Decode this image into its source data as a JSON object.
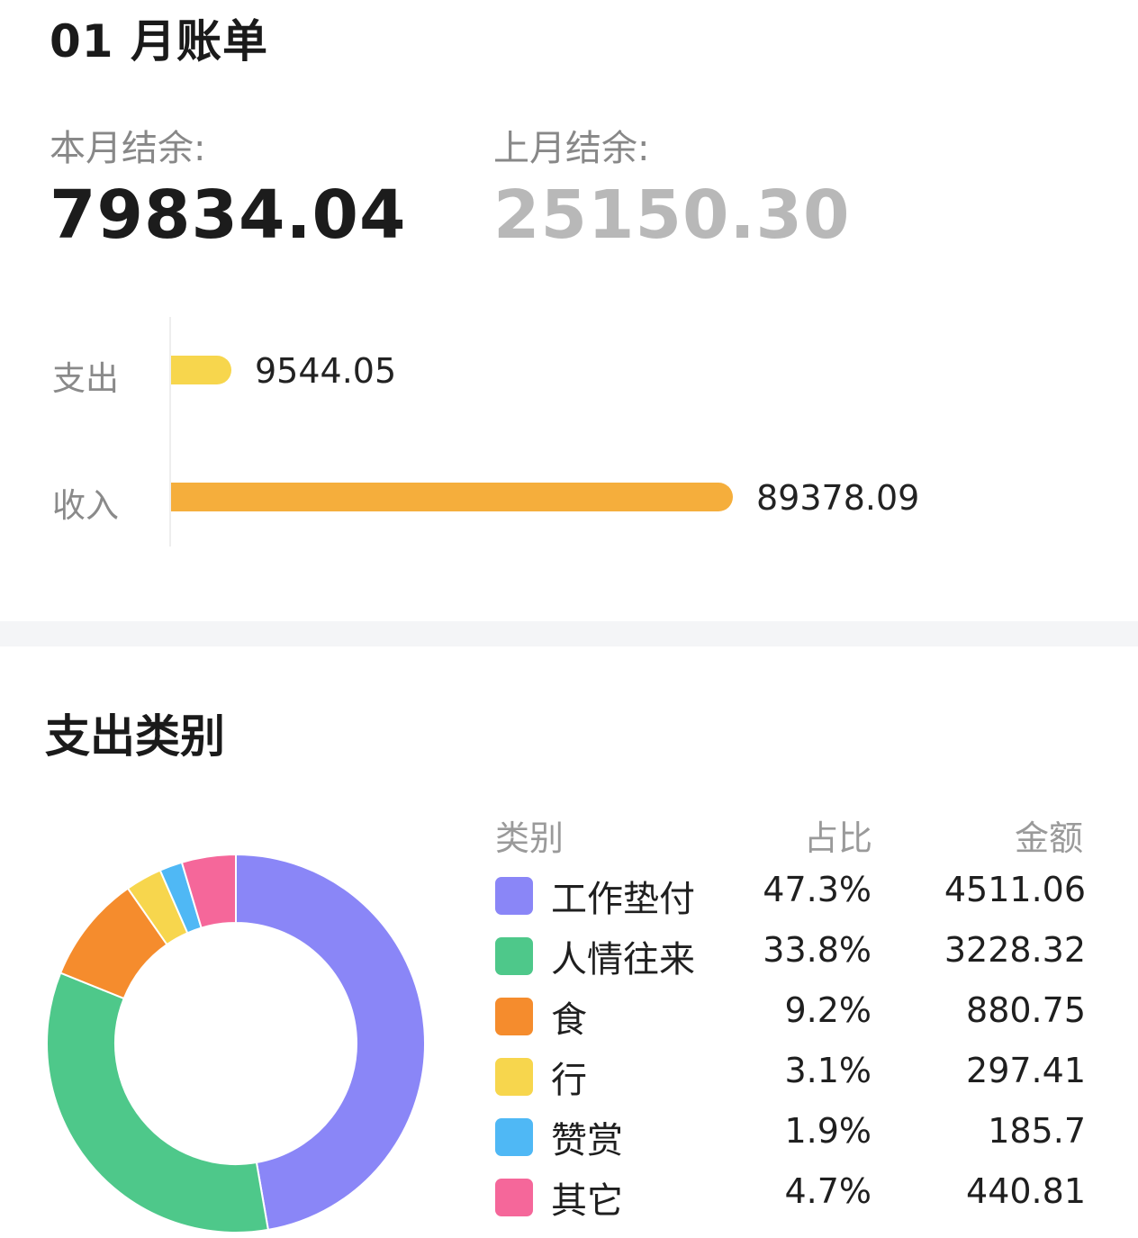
{
  "header": {
    "title": "01 月账单"
  },
  "balance": {
    "current_label": "本月结余:",
    "current_value": "79834.04",
    "previous_label": "上月结余:",
    "previous_value": "25150.30"
  },
  "summary_bars": {
    "items": [
      {
        "label": "支出",
        "value": 9544.05,
        "value_text": "9544.05",
        "color": "#f7d64d"
      },
      {
        "label": "收入",
        "value": 89378.09,
        "value_text": "89378.09",
        "color": "#f5ae3c"
      }
    ]
  },
  "section": {
    "title": "支出类别"
  },
  "chart_data": {
    "type": "pie",
    "style": "donut",
    "columns": [
      "类别",
      "占比",
      "金额"
    ],
    "slices": [
      {
        "label": "工作垫付",
        "percent": 47.3,
        "percent_text": "47.3%",
        "value": 4511.06,
        "value_text": "4511.06",
        "color": "#8a86f7"
      },
      {
        "label": "人情往来",
        "percent": 33.8,
        "percent_text": "33.8%",
        "value": 3228.32,
        "value_text": "3228.32",
        "color": "#4ec88a"
      },
      {
        "label": "食",
        "percent": 9.2,
        "percent_text": "9.2%",
        "value": 880.75,
        "value_text": "880.75",
        "color": "#f58c2d"
      },
      {
        "label": "行",
        "percent": 3.1,
        "percent_text": "3.1%",
        "value": 297.41,
        "value_text": "297.41",
        "color": "#f7d64d"
      },
      {
        "label": "赞赏",
        "percent": 1.9,
        "percent_text": "1.9%",
        "value": 185.7,
        "value_text": "185.7",
        "color": "#4fb8f5"
      },
      {
        "label": "其它",
        "percent": 4.7,
        "percent_text": "4.7%",
        "value": 440.81,
        "value_text": "440.81",
        "color": "#f5679a"
      }
    ]
  }
}
